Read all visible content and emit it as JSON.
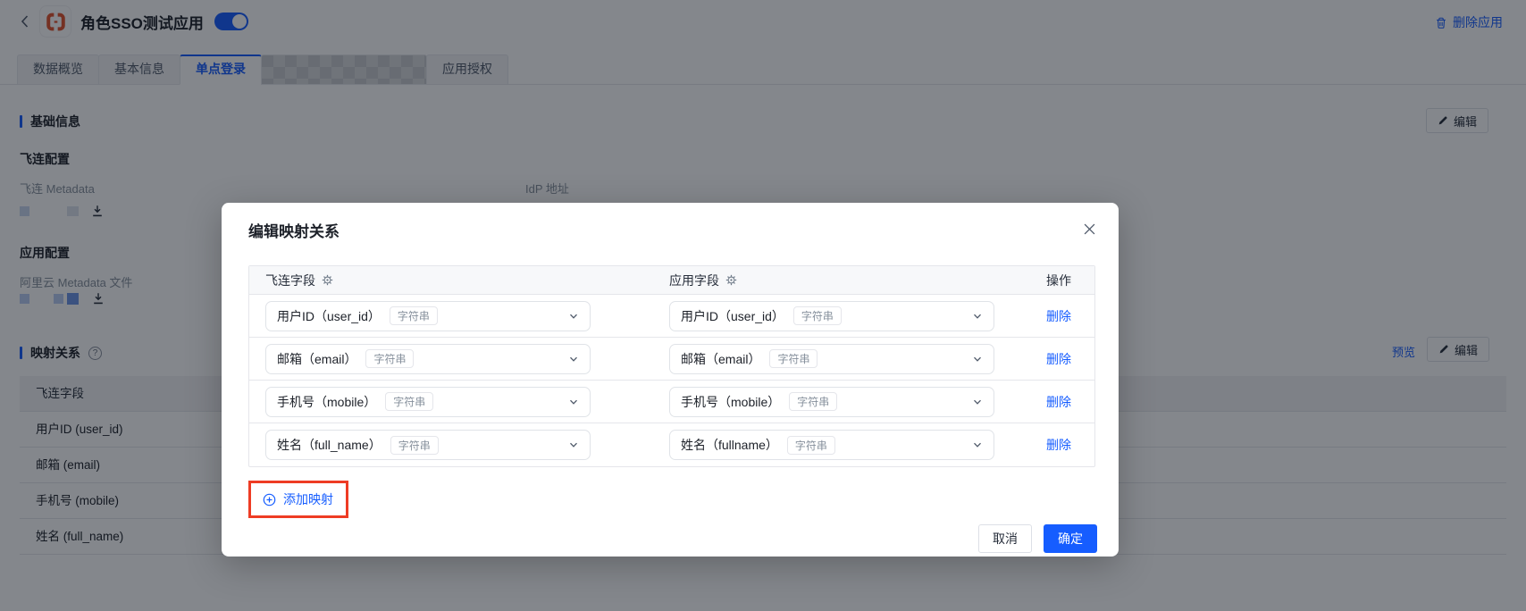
{
  "colors": {
    "primary": "#165dff",
    "annotation_red": "#ee3c24",
    "logo_orange": "#e0522d",
    "border": "#e5e6eb"
  },
  "header": {
    "app_title": "角色SSO测试应用",
    "toggle_state": "on",
    "delete_app": "删除应用"
  },
  "tabs": {
    "active": "单点登录",
    "items": [
      {
        "label": "数据概览"
      },
      {
        "label": "基本信息"
      },
      {
        "label": "单点登录"
      },
      {
        "label": "应用授权"
      }
    ]
  },
  "basic_info": {
    "section_title": "基础信息",
    "edit_button": "编辑",
    "feilian_config_title": "飞连配置",
    "feilian_metadata_label": "飞连 Metadata",
    "idp_address_label": "IdP 地址",
    "app_config_title": "应用配置",
    "aliyun_metadata_label": "阿里云 Metadata 文件"
  },
  "mapping_section": {
    "title": "映射关系",
    "preview_link": "预览",
    "edit_button": "编辑",
    "column_header": "飞连字段",
    "rows": [
      {
        "field": "用户ID (user_id)"
      },
      {
        "field": "邮箱 (email)"
      },
      {
        "field": "手机号 (mobile)"
      },
      {
        "field": "姓名 (full_name)"
      }
    ]
  },
  "modal": {
    "title": "编辑映射关系",
    "columns": {
      "feilian": "飞连字段",
      "app": "应用字段",
      "action": "操作"
    },
    "rows": [
      {
        "feilian": "用户ID（user_id）",
        "feilian_type": "字符串",
        "app": "用户ID（user_id）",
        "app_type": "字符串",
        "action": "删除"
      },
      {
        "feilian": "邮箱（email）",
        "feilian_type": "字符串",
        "app": "邮箱（email）",
        "app_type": "字符串",
        "action": "删除"
      },
      {
        "feilian": "手机号（mobile）",
        "feilian_type": "字符串",
        "app": "手机号（mobile）",
        "app_type": "字符串",
        "action": "删除"
      },
      {
        "feilian": "姓名（full_name）",
        "feilian_type": "字符串",
        "app": "姓名（fullname）",
        "app_type": "字符串",
        "action": "删除"
      }
    ],
    "add_mapping": "添加映射",
    "cancel": "取消",
    "confirm": "确定"
  }
}
